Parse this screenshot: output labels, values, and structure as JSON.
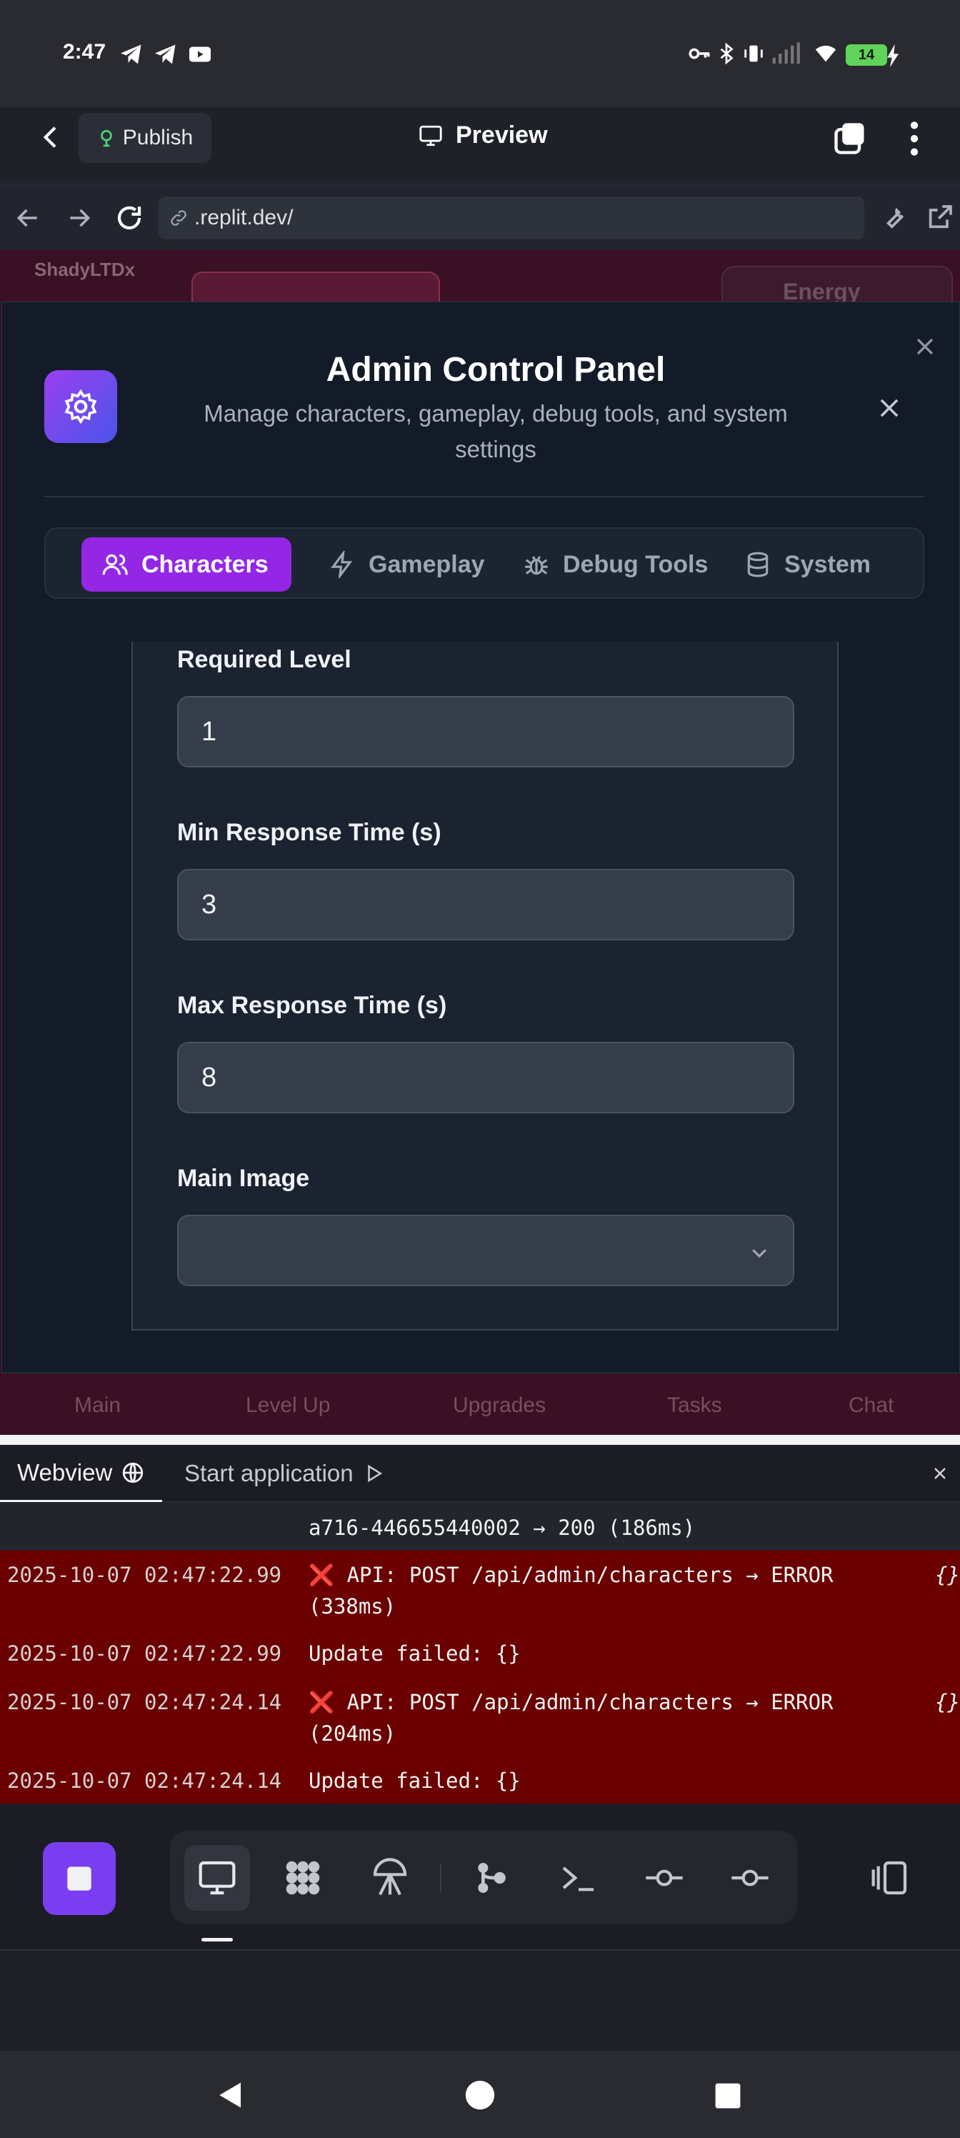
{
  "status_bar": {
    "time": "2:47",
    "battery": "14"
  },
  "top_bar": {
    "publish_label": "Publish",
    "preview_label": "Preview"
  },
  "browser": {
    "url": ".replit.dev/"
  },
  "background_app": {
    "username": "ShadyLTDx",
    "energy_label": "Energy",
    "nav": [
      "Main",
      "Level Up",
      "Upgrades",
      "Tasks",
      "Chat"
    ]
  },
  "modal": {
    "title": "Admin Control Panel",
    "subtitle": "Manage characters, gameplay, debug tools, and system settings",
    "tabs": [
      {
        "label": "Characters",
        "icon": "users-icon"
      },
      {
        "label": "Gameplay",
        "icon": "lightning-icon"
      },
      {
        "label": "Debug Tools",
        "icon": "bug-icon"
      },
      {
        "label": "System",
        "icon": "database-icon"
      }
    ],
    "active_tab": "Characters",
    "fields": [
      {
        "label": "Required Level",
        "value": "1"
      },
      {
        "label": "Min Response Time (s)",
        "value": "3"
      },
      {
        "label": "Max Response Time (s)",
        "value": "8"
      },
      {
        "label": "Main Image",
        "value": ""
      }
    ]
  },
  "console": {
    "tab_webview": "Webview",
    "start_application": "Start application",
    "logs": [
      {
        "ts": "",
        "msg": "a716-446655440002 → 200 (186ms)",
        "obj": "",
        "error": false
      },
      {
        "ts": "2025-10-07 02:47:22.99",
        "msg": "❌ API: POST /api/admin/characters → ERROR\n(338ms)",
        "obj": "{}",
        "error": true
      },
      {
        "ts": "2025-10-07 02:47:22.99",
        "msg": "Update failed: {}",
        "obj": "",
        "error": true
      },
      {
        "ts": "2025-10-07 02:47:24.14",
        "msg": "❌ API: POST /api/admin/characters → ERROR\n(204ms)",
        "obj": "{}",
        "error": true
      },
      {
        "ts": "2025-10-07 02:47:24.14",
        "msg": "Update failed: {}",
        "obj": "",
        "error": true
      }
    ]
  },
  "toolbar": {
    "tools": [
      "preview-icon",
      "packages-icon",
      "deployments-icon",
      "git-icon",
      "shell-icon",
      "commit-icon",
      "commit-icon"
    ]
  }
}
